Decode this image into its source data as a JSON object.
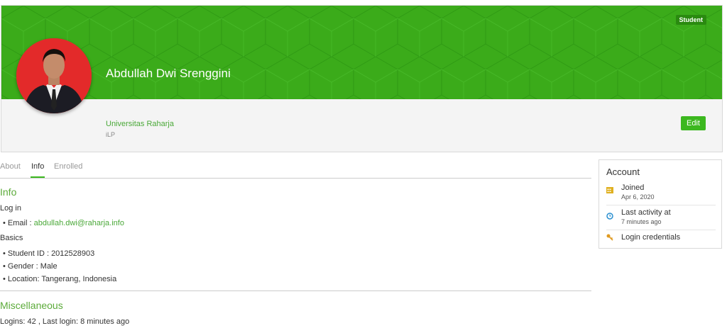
{
  "header": {
    "role_badge": "Student",
    "user_name": "Abdullah Dwi Srenggini",
    "institution": "Universitas Raharja",
    "department": "iLP",
    "edit_label": "Edit"
  },
  "tabs": [
    {
      "label": "About",
      "active": false
    },
    {
      "label": "Info",
      "active": true
    },
    {
      "label": "Enrolled",
      "active": false
    }
  ],
  "info": {
    "title": "Info",
    "login_section": "Log in",
    "email_label": "Email : ",
    "email_value": "abdullah.dwi@raharja.info",
    "basics_section": "Basics",
    "student_id": "Student ID : 2012528903",
    "gender": "Gender : Male",
    "location": "Location: Tangerang, Indonesia"
  },
  "misc": {
    "title": "Miscellaneous",
    "logins": "Logins: 42 , Last login: 8 minutes ago"
  },
  "account": {
    "title": "Account",
    "joined_label": "Joined",
    "joined_value": "Apr 6, 2020",
    "last_activity_label": "Last activity at",
    "last_activity_value": "7 minutes ago",
    "credentials_label": "Login credentials"
  },
  "colors": {
    "accent": "#3cb81f",
    "banner": "#3bab1a",
    "link": "#4aa838",
    "calendar_icon": "#e0b020",
    "clock_icon": "#2a8fd0",
    "key_icon": "#e09a20"
  },
  "icons": [
    "calendar-icon",
    "clock-icon",
    "key-icon"
  ]
}
